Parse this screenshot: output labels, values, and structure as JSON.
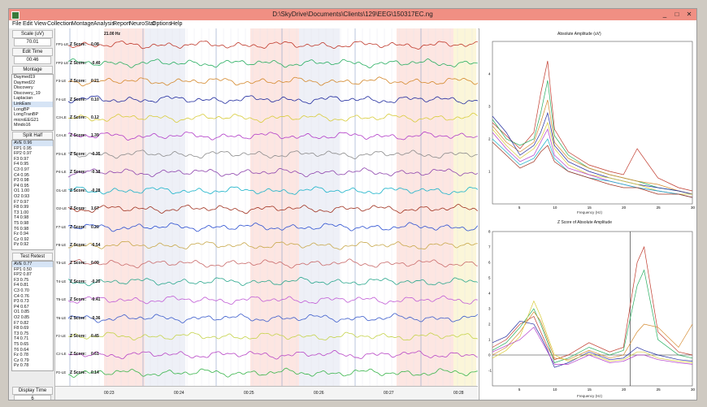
{
  "window": {
    "title": "D:\\SkyDrive\\Documents\\Clients\\129\\EEG\\150317EC.ng",
    "min_label": "_",
    "max_label": "□",
    "close_label": "✕"
  },
  "menu": [
    "File",
    "Edit",
    "View",
    "Collection",
    "Montage",
    "Analysis",
    "Report",
    "NeuroStat",
    "Options",
    "Help"
  ],
  "sidebar": {
    "scale_label": "Scale (uV)",
    "scale_value": "70.01",
    "edit_time_label": "Edit Time",
    "edit_time_value": "00:46",
    "montage_label": "Montage",
    "montage_items": [
      "Daymed19",
      "Daymed22",
      "Discovery",
      "Discovery_19",
      "Laplacian",
      "LinkEars",
      "LongBP",
      "LongTranBP",
      "microEEG21",
      "Mindo16"
    ],
    "montage_selected": 5,
    "split_half_label": "Split Half",
    "split_half_items": [
      "AVE 0.96",
      "FP1 0.95",
      "FP2 0.97",
      "F3 0.97",
      "F4 0.95",
      "C3 0.97",
      "C4 0.95",
      "P3 0.98",
      "P4 0.95",
      "O1 1.00",
      "O2 0.93",
      "F7 0.97",
      "F8 0.99",
      "T3 1.00",
      "T4 0.98",
      "T5 0.98",
      "T6 0.98",
      "Fz 0.94",
      "Cz 0.92",
      "Pz 0.92"
    ],
    "test_retest_label": "Test Retest",
    "test_retest_items": [
      "AVE 0.77",
      "FP1 0.50",
      "FP2 0.87",
      "F3 0.75",
      "F4 0.81",
      "C3 0.70",
      "C4 0.76",
      "P3 0.73",
      "P4 0.67",
      "O1 0.85",
      "O2 0.85",
      "F7 0.82",
      "F8 0.69",
      "T3 0.75",
      "T4 0.71",
      "T5 0.65",
      "T6 0.64",
      "Fz 0.78",
      "Cz 0.79",
      "Pz 0.78"
    ],
    "display_time_label": "Display Time",
    "display_time_value": "6"
  },
  "eeg": {
    "z_prefix": "Z Score:",
    "hz_label": "21.00 Hz",
    "channels": [
      {
        "label": "FP1-LE",
        "z": "0.08",
        "color": "#c0392b"
      },
      {
        "label": "FP2-LE",
        "z": "-0.40",
        "color": "#27ae60"
      },
      {
        "label": "F3-LE",
        "z": "0.21",
        "color": "#d4882b"
      },
      {
        "label": "F4-LE",
        "z": "0.10",
        "color": "#1f2a9e"
      },
      {
        "label": "C3-LE",
        "z": "0.12",
        "color": "#d8cc3a"
      },
      {
        "label": "C4-LE",
        "z": "1.39",
        "color": "#b23cc8"
      },
      {
        "label": "P3-LE",
        "z": "-0.35",
        "color": "#8b8b8b"
      },
      {
        "label": "P4-LE",
        "z": "-0.18",
        "color": "#8e44ad"
      },
      {
        "label": "O1-LE",
        "z": "-0.28",
        "color": "#17b2c9"
      },
      {
        "label": "O2-LE",
        "z": "1.67",
        "color": "#a0311f"
      },
      {
        "label": "F7-LE",
        "z": "0.20",
        "color": "#2b4fd1"
      },
      {
        "label": "F8-LE",
        "z": "-0.54",
        "color": "#c8a84a"
      },
      {
        "label": "T3-LE",
        "z": "0.09",
        "color": "#c96a6a"
      },
      {
        "label": "T4-LE",
        "z": "-0.20",
        "color": "#2aa78d"
      },
      {
        "label": "T5-LE",
        "z": "-0.41",
        "color": "#c15cd6"
      },
      {
        "label": "T6-LE",
        "z": "-0.36",
        "color": "#3b5ccc"
      },
      {
        "label": "Fz-LE",
        "z": "0.45",
        "color": "#c5d34a"
      },
      {
        "label": "Cz-LE",
        "z": "0.61",
        "color": "#b846c6"
      },
      {
        "label": "Pz-LE",
        "z": "0.14",
        "color": "#38b54a"
      }
    ],
    "time_ticks": [
      "00:23",
      "00:24",
      "00:25",
      "00:26",
      "00:27",
      "00:28"
    ]
  },
  "chart_data": [
    {
      "type": "line",
      "title": "Absolute Amplitude (uV)",
      "xlabel": "Frequency (Hz)",
      "x_ticks": [
        5,
        10,
        15,
        20,
        25,
        30
      ],
      "y_ticks": [
        1,
        2,
        3,
        4
      ],
      "xlim": [
        1,
        30
      ],
      "ylim": [
        0,
        5
      ],
      "x": [
        1,
        3,
        5,
        7,
        8,
        9,
        10,
        12,
        15,
        18,
        20,
        22,
        25,
        28,
        30
      ],
      "series": [
        {
          "values": [
            2.5,
            2.1,
            1.7,
            2.2,
            3.4,
            4.4,
            2.3,
            1.6,
            1.2,
            1.0,
            0.9,
            1.7,
            0.8,
            0.5,
            0.4
          ]
        },
        {
          "values": [
            2.6,
            2.0,
            1.8,
            2.0,
            2.8,
            3.8,
            2.1,
            1.5,
            1.1,
            0.9,
            0.8,
            0.7,
            0.5,
            0.4,
            0.3
          ]
        },
        {
          "values": [
            2.4,
            1.9,
            1.6,
            1.9,
            2.5,
            3.2,
            1.9,
            1.4,
            1.1,
            0.9,
            0.8,
            0.7,
            0.6,
            0.4,
            0.3
          ]
        },
        {
          "values": [
            2.7,
            2.2,
            1.5,
            1.8,
            2.2,
            2.8,
            1.8,
            1.3,
            1.0,
            0.8,
            0.7,
            0.6,
            0.5,
            0.4,
            0.3
          ]
        },
        {
          "values": [
            2.3,
            1.8,
            1.4,
            1.7,
            2.0,
            2.5,
            1.7,
            1.2,
            0.9,
            0.8,
            0.7,
            0.6,
            0.4,
            0.3,
            0.3
          ]
        },
        {
          "values": [
            2.2,
            1.7,
            1.3,
            1.5,
            1.9,
            2.3,
            1.5,
            1.1,
            0.9,
            0.7,
            0.6,
            0.5,
            0.4,
            0.3,
            0.2
          ]
        },
        {
          "values": [
            2.0,
            1.6,
            1.2,
            1.4,
            1.7,
            2.0,
            1.4,
            1.0,
            0.8,
            0.7,
            0.6,
            0.5,
            0.4,
            0.3,
            0.2
          ]
        },
        {
          "values": [
            1.9,
            1.5,
            1.1,
            1.3,
            1.6,
            1.8,
            1.3,
            1.0,
            0.8,
            0.6,
            0.5,
            0.5,
            0.3,
            0.3,
            0.2
          ]
        }
      ]
    },
    {
      "type": "line",
      "title": "Z Score of Absolute Amplitude",
      "xlabel": "Frequency (Hz)",
      "x_ticks": [
        5,
        10,
        15,
        20,
        25,
        30
      ],
      "y_ticks": [
        -1,
        0,
        1,
        2,
        3,
        4,
        5,
        6,
        7,
        8
      ],
      "xlim": [
        1,
        30
      ],
      "ylim": [
        -2,
        8
      ],
      "x": [
        1,
        3,
        5,
        7,
        8,
        9,
        10,
        12,
        15,
        18,
        20,
        22,
        23,
        25,
        28,
        30
      ],
      "series": [
        {
          "values": [
            0.5,
            1.0,
            2.0,
            2.5,
            1.5,
            0.5,
            -0.3,
            0.0,
            0.8,
            0.2,
            0.5,
            6.0,
            7.0,
            1.5,
            0.2,
            0.0
          ]
        },
        {
          "values": [
            0.3,
            0.8,
            1.8,
            3.0,
            2.0,
            0.8,
            -0.5,
            -0.2,
            0.5,
            0.0,
            0.3,
            4.5,
            5.5,
            1.0,
            0.0,
            -0.2
          ]
        },
        {
          "values": [
            0.0,
            0.5,
            1.5,
            2.8,
            2.2,
            1.0,
            -0.2,
            -0.3,
            0.3,
            -0.2,
            0.0,
            1.5,
            2.0,
            1.8,
            0.5,
            2.0
          ]
        },
        {
          "values": [
            0.8,
            1.2,
            2.2,
            2.0,
            1.2,
            0.3,
            -0.8,
            -0.5,
            0.2,
            -0.3,
            -0.2,
            0.5,
            0.3,
            0.0,
            -0.3,
            -0.4
          ]
        },
        {
          "values": [
            -0.2,
            0.3,
            1.2,
            3.5,
            2.5,
            1.2,
            0.0,
            -0.4,
            0.1,
            -0.4,
            -0.3,
            0.2,
            0.2,
            -0.2,
            -0.4,
            -0.5
          ]
        },
        {
          "values": [
            0.2,
            0.6,
            1.0,
            1.8,
            1.0,
            0.2,
            -0.6,
            -0.6,
            0.0,
            -0.5,
            -0.4,
            0.0,
            0.0,
            -0.3,
            -0.5,
            -0.6
          ]
        }
      ]
    }
  ]
}
